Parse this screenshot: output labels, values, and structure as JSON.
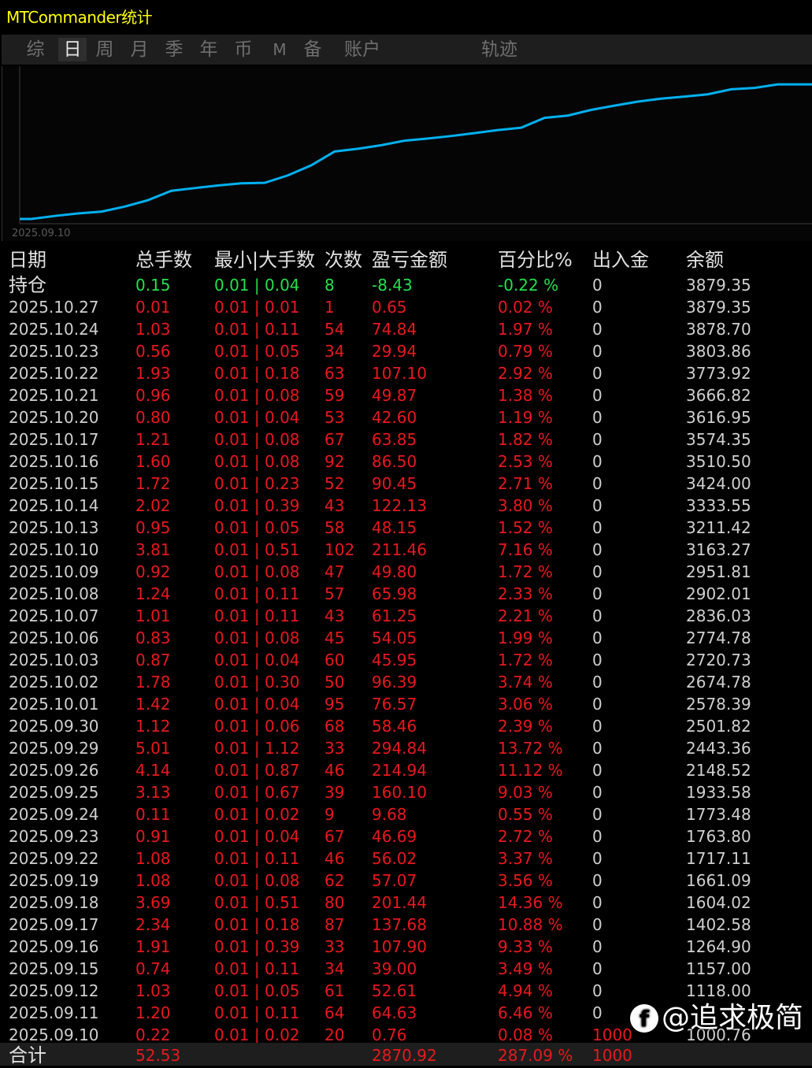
{
  "window": {
    "title": "MTCommander统计"
  },
  "tabs": [
    {
      "label": "综",
      "active": false
    },
    {
      "label": "日",
      "active": true
    },
    {
      "label": "周",
      "active": false
    },
    {
      "label": "月",
      "active": false
    },
    {
      "label": "季",
      "active": false
    },
    {
      "label": "年",
      "active": false
    },
    {
      "label": "币",
      "active": false
    },
    {
      "label": "M",
      "active": false
    },
    {
      "label": "备",
      "active": false
    },
    {
      "label": "账户",
      "active": false
    },
    {
      "label": "轨迹",
      "active": false
    }
  ],
  "chart_data": {
    "type": "line",
    "x_start_label": "2025.09.10",
    "x": [
      "2025.09.10",
      "2025.09.11",
      "2025.09.12",
      "2025.09.15",
      "2025.09.16",
      "2025.09.17",
      "2025.09.18",
      "2025.09.19",
      "2025.09.22",
      "2025.09.23",
      "2025.09.24",
      "2025.09.25",
      "2025.09.26",
      "2025.09.29",
      "2025.09.30",
      "2025.10.01",
      "2025.10.02",
      "2025.10.03",
      "2025.10.06",
      "2025.10.07",
      "2025.10.08",
      "2025.10.09",
      "2025.10.10",
      "2025.10.13",
      "2025.10.14",
      "2025.10.15",
      "2025.10.16",
      "2025.10.17",
      "2025.10.20",
      "2025.10.21",
      "2025.10.22",
      "2025.10.23",
      "2025.10.24",
      "2025.10.27"
    ],
    "series": [
      {
        "values": [
          1000.76,
          1065.39,
          1118.0,
          1157.0,
          1264.9,
          1402.58,
          1604.02,
          1661.09,
          1717.11,
          1763.8,
          1773.48,
          1933.58,
          2148.52,
          2443.36,
          2501.82,
          2578.39,
          2674.78,
          2720.73,
          2774.78,
          2836.03,
          2902.01,
          2951.81,
          3163.27,
          3211.42,
          3333.55,
          3424.0,
          3510.5,
          3574.35,
          3616.95,
          3666.82,
          3773.92,
          3803.86,
          3878.7,
          3879.35
        ],
        "color": "#00b0f0"
      }
    ],
    "grid": false,
    "legend": "none"
  },
  "table": {
    "headers": {
      "date": "日期",
      "lots": "总手数",
      "minmax": "最小|大手数",
      "count": "次数",
      "pnl": "盈亏金额",
      "pct": "百分比%",
      "flow": "出入金",
      "balance": "余额"
    },
    "holding": {
      "date": "持仓",
      "lots": "0.15",
      "minmax": "0.01 | 0.04",
      "count": "8",
      "pnl": "-8.43",
      "pct": "-0.22 %",
      "flow": "0",
      "balance": "3879.35"
    },
    "rows": [
      {
        "date": "2025.10.27",
        "lots": "0.01",
        "minmax": "0.01 | 0.01",
        "count": "1",
        "pnl": "0.65",
        "pct": "0.02 %",
        "flow": "0",
        "balance": "3879.35"
      },
      {
        "date": "2025.10.24",
        "lots": "1.03",
        "minmax": "0.01 | 0.11",
        "count": "54",
        "pnl": "74.84",
        "pct": "1.97 %",
        "flow": "0",
        "balance": "3878.70"
      },
      {
        "date": "2025.10.23",
        "lots": "0.56",
        "minmax": "0.01 | 0.05",
        "count": "34",
        "pnl": "29.94",
        "pct": "0.79 %",
        "flow": "0",
        "balance": "3803.86"
      },
      {
        "date": "2025.10.22",
        "lots": "1.93",
        "minmax": "0.01 | 0.18",
        "count": "63",
        "pnl": "107.10",
        "pct": "2.92 %",
        "flow": "0",
        "balance": "3773.92"
      },
      {
        "date": "2025.10.21",
        "lots": "0.96",
        "minmax": "0.01 | 0.08",
        "count": "59",
        "pnl": "49.87",
        "pct": "1.38 %",
        "flow": "0",
        "balance": "3666.82"
      },
      {
        "date": "2025.10.20",
        "lots": "0.80",
        "minmax": "0.01 | 0.04",
        "count": "53",
        "pnl": "42.60",
        "pct": "1.19 %",
        "flow": "0",
        "balance": "3616.95"
      },
      {
        "date": "2025.10.17",
        "lots": "1.21",
        "minmax": "0.01 | 0.08",
        "count": "67",
        "pnl": "63.85",
        "pct": "1.82 %",
        "flow": "0",
        "balance": "3574.35"
      },
      {
        "date": "2025.10.16",
        "lots": "1.60",
        "minmax": "0.01 | 0.08",
        "count": "92",
        "pnl": "86.50",
        "pct": "2.53 %",
        "flow": "0",
        "balance": "3510.50"
      },
      {
        "date": "2025.10.15",
        "lots": "1.72",
        "minmax": "0.01 | 0.23",
        "count": "52",
        "pnl": "90.45",
        "pct": "2.71 %",
        "flow": "0",
        "balance": "3424.00"
      },
      {
        "date": "2025.10.14",
        "lots": "2.02",
        "minmax": "0.01 | 0.39",
        "count": "43",
        "pnl": "122.13",
        "pct": "3.80 %",
        "flow": "0",
        "balance": "3333.55"
      },
      {
        "date": "2025.10.13",
        "lots": "0.95",
        "minmax": "0.01 | 0.05",
        "count": "58",
        "pnl": "48.15",
        "pct": "1.52 %",
        "flow": "0",
        "balance": "3211.42"
      },
      {
        "date": "2025.10.10",
        "lots": "3.81",
        "minmax": "0.01 | 0.51",
        "count": "102",
        "pnl": "211.46",
        "pct": "7.16 %",
        "flow": "0",
        "balance": "3163.27"
      },
      {
        "date": "2025.10.09",
        "lots": "0.92",
        "minmax": "0.01 | 0.08",
        "count": "47",
        "pnl": "49.80",
        "pct": "1.72 %",
        "flow": "0",
        "balance": "2951.81"
      },
      {
        "date": "2025.10.08",
        "lots": "1.24",
        "minmax": "0.01 | 0.11",
        "count": "57",
        "pnl": "65.98",
        "pct": "2.33 %",
        "flow": "0",
        "balance": "2902.01"
      },
      {
        "date": "2025.10.07",
        "lots": "1.01",
        "minmax": "0.01 | 0.11",
        "count": "43",
        "pnl": "61.25",
        "pct": "2.21 %",
        "flow": "0",
        "balance": "2836.03"
      },
      {
        "date": "2025.10.06",
        "lots": "0.83",
        "minmax": "0.01 | 0.08",
        "count": "45",
        "pnl": "54.05",
        "pct": "1.99 %",
        "flow": "0",
        "balance": "2774.78"
      },
      {
        "date": "2025.10.03",
        "lots": "0.87",
        "minmax": "0.01 | 0.04",
        "count": "60",
        "pnl": "45.95",
        "pct": "1.72 %",
        "flow": "0",
        "balance": "2720.73"
      },
      {
        "date": "2025.10.02",
        "lots": "1.78",
        "minmax": "0.01 | 0.30",
        "count": "50",
        "pnl": "96.39",
        "pct": "3.74 %",
        "flow": "0",
        "balance": "2674.78"
      },
      {
        "date": "2025.10.01",
        "lots": "1.42",
        "minmax": "0.01 | 0.04",
        "count": "95",
        "pnl": "76.57",
        "pct": "3.06 %",
        "flow": "0",
        "balance": "2578.39"
      },
      {
        "date": "2025.09.30",
        "lots": "1.12",
        "minmax": "0.01 | 0.06",
        "count": "68",
        "pnl": "58.46",
        "pct": "2.39 %",
        "flow": "0",
        "balance": "2501.82"
      },
      {
        "date": "2025.09.29",
        "lots": "5.01",
        "minmax": "0.01 | 1.12",
        "count": "33",
        "pnl": "294.84",
        "pct": "13.72 %",
        "flow": "0",
        "balance": "2443.36"
      },
      {
        "date": "2025.09.26",
        "lots": "4.14",
        "minmax": "0.01 | 0.87",
        "count": "46",
        "pnl": "214.94",
        "pct": "11.12 %",
        "flow": "0",
        "balance": "2148.52"
      },
      {
        "date": "2025.09.25",
        "lots": "3.13",
        "minmax": "0.01 | 0.67",
        "count": "39",
        "pnl": "160.10",
        "pct": "9.03 %",
        "flow": "0",
        "balance": "1933.58"
      },
      {
        "date": "2025.09.24",
        "lots": "0.11",
        "minmax": "0.01 | 0.02",
        "count": "9",
        "pnl": "9.68",
        "pct": "0.55 %",
        "flow": "0",
        "balance": "1773.48"
      },
      {
        "date": "2025.09.23",
        "lots": "0.91",
        "minmax": "0.01 | 0.04",
        "count": "67",
        "pnl": "46.69",
        "pct": "2.72 %",
        "flow": "0",
        "balance": "1763.80"
      },
      {
        "date": "2025.09.22",
        "lots": "1.08",
        "minmax": "0.01 | 0.11",
        "count": "46",
        "pnl": "56.02",
        "pct": "3.37 %",
        "flow": "0",
        "balance": "1717.11"
      },
      {
        "date": "2025.09.19",
        "lots": "1.08",
        "minmax": "0.01 | 0.08",
        "count": "62",
        "pnl": "57.07",
        "pct": "3.56 %",
        "flow": "0",
        "balance": "1661.09"
      },
      {
        "date": "2025.09.18",
        "lots": "3.69",
        "minmax": "0.01 | 0.51",
        "count": "80",
        "pnl": "201.44",
        "pct": "14.36 %",
        "flow": "0",
        "balance": "1604.02"
      },
      {
        "date": "2025.09.17",
        "lots": "2.34",
        "minmax": "0.01 | 0.18",
        "count": "87",
        "pnl": "137.68",
        "pct": "10.88 %",
        "flow": "0",
        "balance": "1402.58"
      },
      {
        "date": "2025.09.16",
        "lots": "1.91",
        "minmax": "0.01 | 0.39",
        "count": "33",
        "pnl": "107.90",
        "pct": "9.33 %",
        "flow": "0",
        "balance": "1264.90"
      },
      {
        "date": "2025.09.15",
        "lots": "0.74",
        "minmax": "0.01 | 0.11",
        "count": "34",
        "pnl": "39.00",
        "pct": "3.49 %",
        "flow": "0",
        "balance": "1157.00"
      },
      {
        "date": "2025.09.12",
        "lots": "1.03",
        "minmax": "0.01 | 0.05",
        "count": "61",
        "pnl": "52.61",
        "pct": "4.94 %",
        "flow": "0",
        "balance": "1118.00"
      },
      {
        "date": "2025.09.11",
        "lots": "1.20",
        "minmax": "0.01 | 0.11",
        "count": "64",
        "pnl": "64.63",
        "pct": "6.46 %",
        "flow": "0",
        "balance": ""
      },
      {
        "date": "2025.09.10",
        "lots": "0.22",
        "minmax": "0.01 | 0.02",
        "count": "20",
        "pnl": "0.76",
        "pct": "0.08 %",
        "flow": "1000",
        "balance": "1000.76"
      }
    ],
    "total": {
      "label": "合计",
      "lots": "52.53",
      "pnl": "2870.92",
      "pct": "287.09 %",
      "flow": "1000"
    }
  },
  "watermark": {
    "logo_icon": "facebook-f-icon",
    "logo_glyph": "f",
    "text": "@追求极简"
  },
  "colors": {
    "title": "#ffff00",
    "profit": "#e8191c",
    "holding": "#22e04a",
    "line": "#00b0f0",
    "background": "#000000"
  }
}
